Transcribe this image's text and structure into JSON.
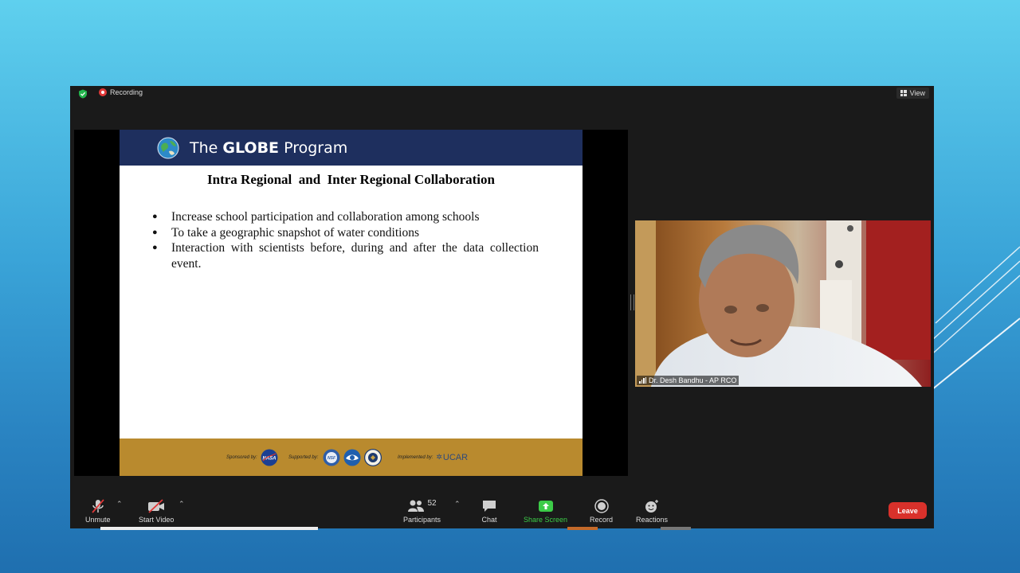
{
  "meeting": {
    "recording_label": "Recording",
    "view_label": "View"
  },
  "slide": {
    "program_title_prefix": "The ",
    "program_title_bold": "GLOBE",
    "program_title_suffix": " Program",
    "title": "Intra Regional  and  Inter Regional Collaboration",
    "bullets": [
      "Increase school participation and collaboration among schools",
      "To take a geographic snapshot of water conditions",
      "Interaction with scientists before, during and after the data collection event."
    ],
    "footer": {
      "sponsored_by": "Sponsored by:",
      "nasa": "NASA",
      "supported_by": "Supported by:",
      "nsf": "NSF",
      "implemented_by": "Implemented by:",
      "ucar": "UCAR"
    }
  },
  "video": {
    "participant_name": "Dr. Desh Bandhu - AP RCO"
  },
  "toolbar": {
    "unmute_label": "Unmute",
    "start_video_label": "Start Video",
    "participants_label": "Participants",
    "participants_count": "52",
    "chat_label": "Chat",
    "share_screen_label": "Share Screen",
    "record_label": "Record",
    "reactions_label": "Reactions",
    "leave_label": "Leave"
  },
  "colors": {
    "header_navy": "#1e2f5e",
    "footer_gold": "#b98a2e",
    "leave_red": "#d9312b",
    "share_green": "#3ccc48"
  }
}
